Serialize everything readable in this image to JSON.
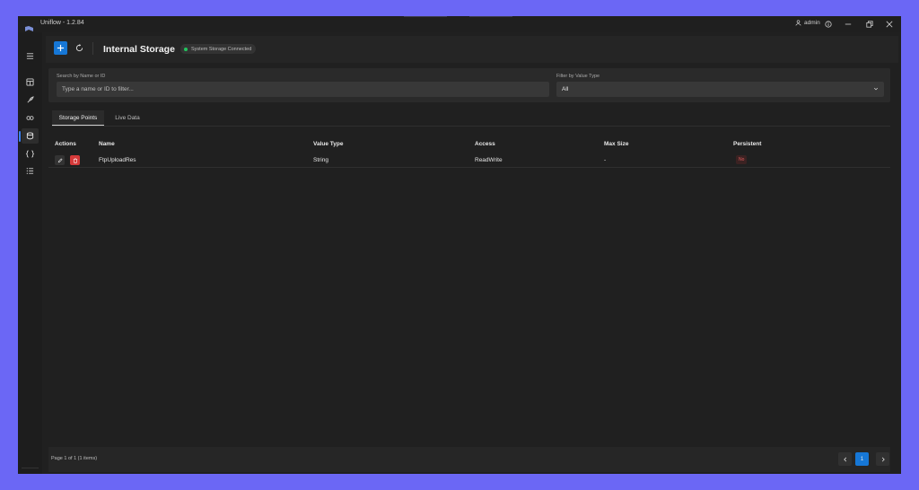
{
  "window": {
    "title": "Uniflow - 1.2.84",
    "user": "admin"
  },
  "header": {
    "title": "Internal Storage",
    "status": "System Storage Connected"
  },
  "filters": {
    "search_label": "Search by Name or ID",
    "search_placeholder": "Type a name or ID to filter...",
    "type_label": "Filter by Value Type",
    "type_value": "All"
  },
  "tabs": [
    {
      "label": "Storage Points",
      "active": true
    },
    {
      "label": "Live Data",
      "active": false
    }
  ],
  "table": {
    "columns": [
      "Actions",
      "Name",
      "Value Type",
      "Access",
      "Max Size",
      "Persistent"
    ],
    "rows": [
      {
        "name": "FtpUploadRes",
        "value_type": "String",
        "access": "ReadWrite",
        "max_size": "-",
        "persistent": "No"
      }
    ]
  },
  "pagination": {
    "info": "Page 1 of 1 (1 items)",
    "current": "1"
  },
  "colors": {
    "accent": "#1677d6",
    "danger": "#d63a3a",
    "status_ok": "#22c55e",
    "frame": "#6b67f5"
  },
  "icons": {
    "sidebar": [
      "menu-icon",
      "dashboard-icon",
      "rocket-icon",
      "connections-icon",
      "database-icon",
      "code-braces-icon",
      "list-icon",
      "settings-icon"
    ]
  }
}
